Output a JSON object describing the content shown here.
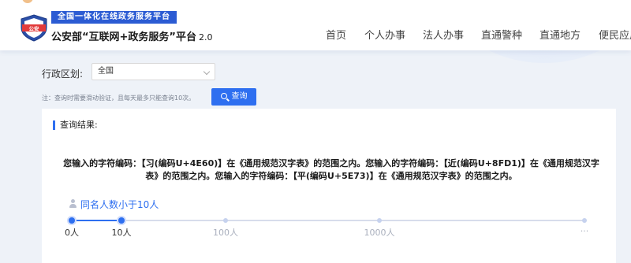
{
  "header": {
    "badge_text": "公安",
    "slogan": "全国一体化在线政务服务平台",
    "brand": "公安部“互联网+政务服务”平台",
    "version": "2.0",
    "nav": [
      "首页",
      "个人办事",
      "法人办事",
      "直通警种",
      "直通地方",
      "便民应用"
    ]
  },
  "form": {
    "region_label": "行政区划:",
    "region_value": "全国",
    "note": "注：查询时需要滑动验证，且每天最多只能查询10次。",
    "query_button": "查询"
  },
  "results": {
    "title": "查询结果:",
    "message": "您输入的字符编码：【习(编码U+4E60)】在《通用规范汉字表》的范围之内。您输入的字符编码：【近(编码U+8FD1)】在《通用规范汉字表》的范围之内。您输入的字符编码：【平(编码U+5E73)】在《通用规范汉字表》的范围之内。",
    "same_name_count": "同名人数小于10人"
  },
  "scale": {
    "labels": [
      "0人",
      "10人",
      "100人",
      "1000人",
      "···"
    ],
    "active_level": 1
  },
  "colors": {
    "accent": "#2e6ff0",
    "slogan_bg": "#2b5bd3",
    "badge_red": "#e23a3a"
  }
}
